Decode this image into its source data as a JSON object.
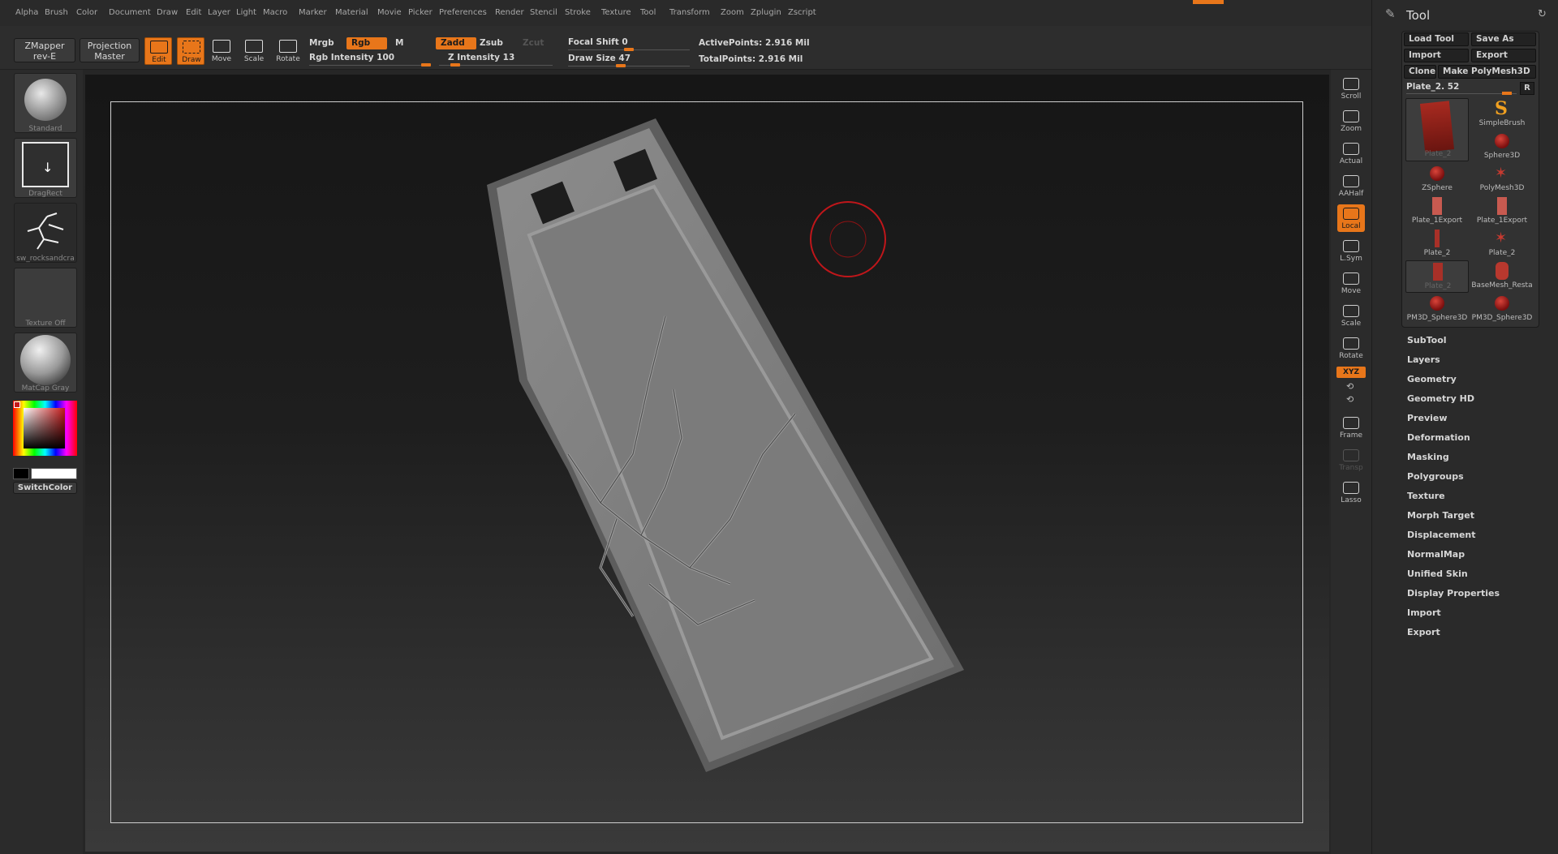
{
  "menu": {
    "items": [
      "Alpha",
      "Brush",
      "Color",
      "Document",
      "Draw",
      "Edit",
      "Layer",
      "Light",
      "Macro",
      "Marker",
      "Material",
      "Movie",
      "Picker",
      "Preferences",
      "Render",
      "Stencil",
      "Stroke",
      "Texture",
      "Tool",
      "Transform",
      "Zoom",
      "Zplugin",
      "Zscript"
    ]
  },
  "shelf": {
    "zmapper": {
      "line1": "ZMapper",
      "line2": "rev-E"
    },
    "projection": {
      "line1": "Projection",
      "line2": "Master"
    },
    "tools": [
      "Edit",
      "Draw",
      "Move",
      "Scale",
      "Rotate"
    ],
    "mrgb": "Mrgb",
    "rgb": "Rgb",
    "m": "M",
    "rgb_intensity": {
      "label": "Rgb Intensity",
      "value": "100"
    },
    "zadd": "Zadd",
    "zsub": "Zsub",
    "zcut": "Zcut",
    "z_intensity": {
      "label": "Z Intensity",
      "value": "13"
    },
    "focal_shift": {
      "label": "Focal Shift",
      "value": "0"
    },
    "draw_size": {
      "label": "Draw Size",
      "value": "47"
    },
    "active_points": {
      "label": "ActivePoints:",
      "value": "2.916 Mil"
    },
    "total_points": {
      "label": "TotalPoints:",
      "value": "2.916 Mil"
    }
  },
  "left": {
    "brush": "Standard",
    "stroke": "DragRect",
    "alpha": "sw_rocksandcra",
    "texture": "Texture Off",
    "material": "MatCap Gray",
    "switch_color": "SwitchColor"
  },
  "right_shelf": [
    {
      "label": "Scroll",
      "state": "normal"
    },
    {
      "label": "Zoom",
      "state": "normal"
    },
    {
      "label": "Actual",
      "state": "normal"
    },
    {
      "label": "AAHalf",
      "state": "normal"
    },
    {
      "label": "Local",
      "state": "active"
    },
    {
      "label": "L.Sym",
      "state": "normal"
    },
    {
      "label": "Move",
      "state": "normal"
    },
    {
      "label": "Scale",
      "state": "normal"
    },
    {
      "label": "Rotate",
      "state": "normal"
    },
    {
      "label": "Frame",
      "state": "normal"
    },
    {
      "label": "Transp",
      "state": "dim"
    },
    {
      "label": "Lasso",
      "state": "normal"
    }
  ],
  "xyz": "XYZ",
  "palette": {
    "title": "Tool",
    "load_tool": "Load Tool",
    "save_as": "Save As",
    "import": "Import",
    "export": "Export",
    "clone": "Clone",
    "make_polymesh": "Make PolyMesh3D",
    "current_tool": "Plate_2. 52",
    "r": "R",
    "tools": [
      "Plate_2",
      "SimpleBrush",
      "Sphere3D",
      "ZSphere",
      "PolyMesh3D",
      "Plate_1Export",
      "Plate_1Export",
      "Plate_2",
      "Plate_2",
      "Plate_2",
      "BaseMesh_Resta",
      "PM3D_Sphere3D",
      "PM3D_Sphere3D"
    ],
    "subpalettes": [
      "SubTool",
      "Layers",
      "Geometry",
      "Geometry HD",
      "Preview",
      "Deformation",
      "Masking",
      "Polygroups",
      "Texture",
      "Morph Target",
      "Displacement",
      "NormalMap",
      "Unified Skin",
      "Display Properties",
      "Import",
      "Export"
    ]
  },
  "colors": {
    "accent": "#e8761a",
    "brush_cursor": "#c0161a"
  }
}
